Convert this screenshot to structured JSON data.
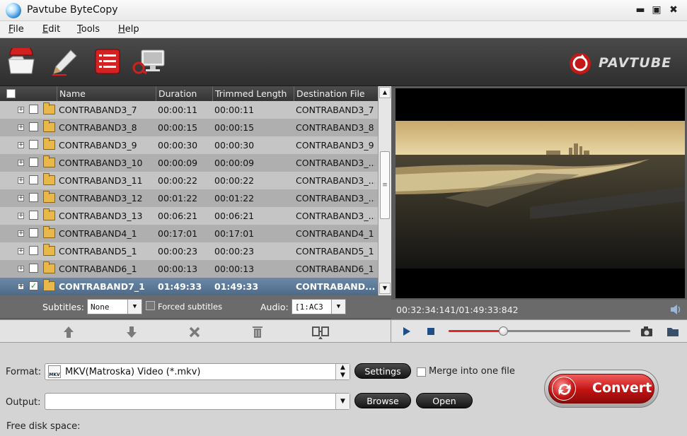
{
  "window": {
    "title": "Pavtube ByteCopy",
    "minimize_glyph": "▬",
    "maximize_glyph": "▣",
    "close_glyph": "✖"
  },
  "menu": [
    {
      "key": "F",
      "rest": "ile"
    },
    {
      "key": "E",
      "rest": "dit"
    },
    {
      "key": "T",
      "rest": "ools"
    },
    {
      "key": "H",
      "rest": "elp"
    }
  ],
  "toolbar": {
    "icons": [
      "open-disc-icon",
      "edit-pencil-icon",
      "list-icon",
      "playback-monitor-icon"
    ]
  },
  "brand": {
    "logo_text": "PAVTUBE"
  },
  "file_list": {
    "columns": [
      "Name",
      "Duration",
      "Trimmed Length",
      "Destination File"
    ],
    "rows": [
      {
        "name": "CONTRABAND3_7",
        "duration": "00:00:11",
        "trimmed": "00:00:11",
        "dest": "CONTRABAND3_7",
        "checked": false
      },
      {
        "name": "CONTRABAND3_8",
        "duration": "00:00:15",
        "trimmed": "00:00:15",
        "dest": "CONTRABAND3_8",
        "checked": false
      },
      {
        "name": "CONTRABAND3_9",
        "duration": "00:00:30",
        "trimmed": "00:00:30",
        "dest": "CONTRABAND3_9",
        "checked": false
      },
      {
        "name": "CONTRABAND3_10",
        "duration": "00:00:09",
        "trimmed": "00:00:09",
        "dest": "CONTRABAND3_...",
        "checked": false
      },
      {
        "name": "CONTRABAND3_11",
        "duration": "00:00:22",
        "trimmed": "00:00:22",
        "dest": "CONTRABAND3_...",
        "checked": false
      },
      {
        "name": "CONTRABAND3_12",
        "duration": "00:01:22",
        "trimmed": "00:01:22",
        "dest": "CONTRABAND3_...",
        "checked": false
      },
      {
        "name": "CONTRABAND3_13",
        "duration": "00:06:21",
        "trimmed": "00:06:21",
        "dest": "CONTRABAND3_...",
        "checked": false
      },
      {
        "name": "CONTRABAND4_1",
        "duration": "00:17:01",
        "trimmed": "00:17:01",
        "dest": "CONTRABAND4_1",
        "checked": false
      },
      {
        "name": "CONTRABAND5_1",
        "duration": "00:00:23",
        "trimmed": "00:00:23",
        "dest": "CONTRABAND5_1",
        "checked": false
      },
      {
        "name": "CONTRABAND6_1",
        "duration": "00:00:13",
        "trimmed": "00:00:13",
        "dest": "CONTRABAND6_1",
        "checked": false
      },
      {
        "name": "CONTRABAND7_1",
        "duration": "01:49:33",
        "trimmed": "01:49:33",
        "dest": "CONTRABAND...",
        "checked": true,
        "selected": true
      }
    ]
  },
  "subtitle_bar": {
    "subtitles_label": "Subtitles:",
    "subtitles_value": "None",
    "forced_label": "Forced subtitles",
    "audio_label": "Audio:",
    "audio_value": "[1:AC3"
  },
  "list_actions": [
    "move-up-icon",
    "move-down-icon",
    "remove-icon",
    "delete-all-icon",
    "merge-icon"
  ],
  "player": {
    "time_display": "00:32:34:141/01:49:33:842",
    "progress": 0.3
  },
  "output": {
    "format_label": "Format:",
    "format_value": "MKV(Matroska) Video (*.mkv)",
    "format_icon_text": "MKV",
    "settings_label": "Settings",
    "merge_label": "Merge into one file",
    "output_label": "Output:",
    "output_value": "",
    "browse_label": "Browse",
    "open_label": "Open",
    "free_disk_label": "Free disk space:",
    "convert_label": "Convert"
  },
  "colors": {
    "accent_red": "#d01818",
    "selected_row": "#5a7896",
    "toolbar_dark": "#3a3a3a"
  }
}
